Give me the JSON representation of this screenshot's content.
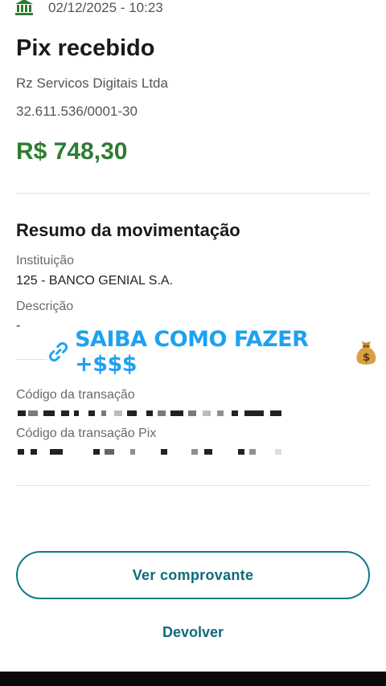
{
  "header": {
    "timestamp": "02/12/2025 - 10:23",
    "icon": "bank-icon"
  },
  "transfer": {
    "title": "Pix recebido",
    "sender_name": "Rz Servicos Digitais Ltda",
    "sender_document": "32.611.536/0001-30",
    "amount": "R$ 748,30",
    "amount_color": "#2e7d32"
  },
  "summary": {
    "title": "Resumo da movimentação",
    "institution_label": "Instituição",
    "institution_value": "125 - BANCO GENIAL S.A.",
    "description_label": "Descrição",
    "description_value": "-",
    "transaction_code_label": "Código da transação",
    "pix_code_label": "Código da transação Pix"
  },
  "promo": {
    "text": "SAIBA COMO FAZER +$$$",
    "color": "#1ea1f2",
    "icons": [
      "link-icon",
      "money-bag-icon"
    ]
  },
  "actions": {
    "receipt_label": "Ver comprovante",
    "return_label": "Devolver",
    "accent": "#0e7a8a"
  }
}
